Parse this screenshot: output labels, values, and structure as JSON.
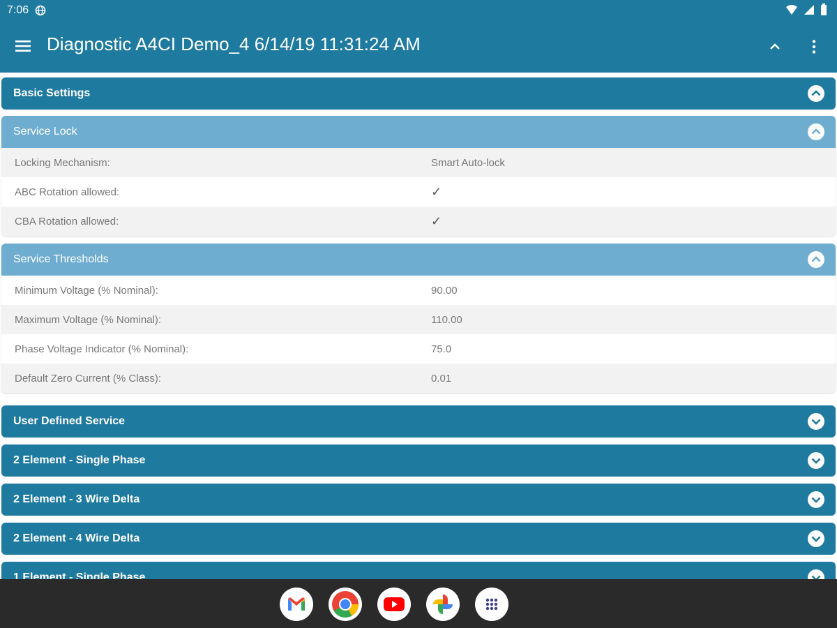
{
  "status_bar": {
    "time": "7:06"
  },
  "app_bar": {
    "title": "Diagnostic A4CI Demo_4 6/14/19 11:31:24 AM"
  },
  "sections": [
    {
      "id": "basic",
      "title": "Basic Settings",
      "expanded": true
    },
    {
      "id": "service-lock",
      "title": "Service Lock",
      "expanded": true,
      "rows": [
        {
          "label": "Locking Mechanism:",
          "value": "Smart Auto-lock"
        },
        {
          "label": "ABC Rotation allowed:",
          "value": "✓"
        },
        {
          "label": "CBA Rotation allowed:",
          "value": "✓"
        }
      ]
    },
    {
      "id": "service-thresholds",
      "title": "Service Thresholds",
      "expanded": true,
      "rows": [
        {
          "label": "Minimum Voltage (% Nominal):",
          "value": "90.00"
        },
        {
          "label": "Maximum Voltage (% Nominal):",
          "value": "110.00"
        },
        {
          "label": "Phase Voltage Indicator (% Nominal):",
          "value": "75.0"
        },
        {
          "label": "Default Zero Current (% Class):",
          "value": "0.01"
        }
      ]
    },
    {
      "id": "user-defined",
      "title": "User Defined Service",
      "expanded": false
    },
    {
      "id": "2e-single",
      "title": "2 Element - Single Phase",
      "expanded": false
    },
    {
      "id": "2e-3wire",
      "title": "2 Element - 3 Wire Delta",
      "expanded": false
    },
    {
      "id": "2e-4wire",
      "title": "2 Element - 4 Wire Delta",
      "expanded": false
    },
    {
      "id": "1e-single",
      "title": "1 Element - Single Phase",
      "expanded": false
    }
  ],
  "dock": [
    "gmail-icon",
    "chrome-icon",
    "youtube-icon",
    "photos-icon",
    "apps-icon"
  ],
  "colors": {
    "primary": "#1f7aa0",
    "subheader": "#6fadd0",
    "row_alt": "#f2f2f2",
    "navbar": "#2a2a2a"
  }
}
